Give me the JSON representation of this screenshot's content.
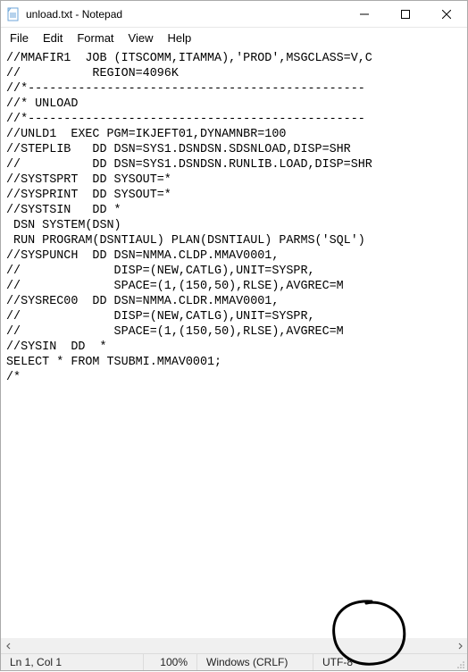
{
  "window": {
    "title": "unload.txt - Notepad"
  },
  "menu": {
    "file": "File",
    "edit": "Edit",
    "format": "Format",
    "view": "View",
    "help": "Help"
  },
  "editor": {
    "content": "//MMAFIR1  JOB (ITSCOMM,ITAMMA),'PROD',MSGCLASS=V,C\n//          REGION=4096K\n//*-----------------------------------------------\n//* UNLOAD\n//*-----------------------------------------------\n//UNLD1  EXEC PGM=IKJEFT01,DYNAMNBR=100\n//STEPLIB   DD DSN=SYS1.DSNDSN.SDSNLOAD,DISP=SHR\n//          DD DSN=SYS1.DSNDSN.RUNLIB.LOAD,DISP=SHR\n//SYSTSPRT  DD SYSOUT=*\n//SYSPRINT  DD SYSOUT=*\n//SYSTSIN   DD *\n DSN SYSTEM(DSN)\n RUN PROGRAM(DSNTIAUL) PLAN(DSNTIAUL) PARMS('SQL')\n//SYSPUNCH  DD DSN=NMMA.CLDP.MMAV0001,\n//             DISP=(NEW,CATLG),UNIT=SYSPR,\n//             SPACE=(1,(150,50),RLSE),AVGREC=M\n//SYSREC00  DD DSN=NMMA.CLDR.MMAV0001,\n//             DISP=(NEW,CATLG),UNIT=SYSPR,\n//             SPACE=(1,(150,50),RLSE),AVGREC=M\n//SYSIN  DD  *\nSELECT * FROM TSUBMI.MMAV0001;\n/*"
  },
  "status": {
    "position": "Ln 1, Col 1",
    "zoom": "100%",
    "eol": "Windows (CRLF)",
    "encoding": "UTF-8"
  }
}
